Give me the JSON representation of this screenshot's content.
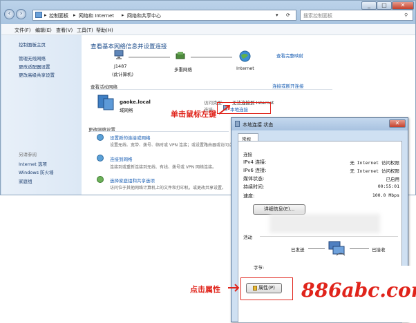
{
  "window": {
    "breadcrumb": [
      "控制面板",
      "网络和 Internet",
      "网络和共享中心"
    ],
    "search_placeholder": "搜索控制面板",
    "controls": {
      "min": "_",
      "max": "□",
      "close": "✕"
    }
  },
  "menu": [
    "文件(F)",
    "编辑(E)",
    "查看(V)",
    "工具(T)",
    "帮助(H)"
  ],
  "sidebar": {
    "items": [
      "控制面板主页",
      "管理无线网络",
      "更改适配器设置",
      "更改高级共享设置"
    ],
    "see_also_title": "另请参阅",
    "see_also": [
      "Internet 选项",
      "Windows 防火墙",
      "家庭组"
    ]
  },
  "main": {
    "heading": "查看基本网络信息并设置连接",
    "full_map": "查看完整映射",
    "map_nodes": [
      {
        "label": "J1487",
        "sub": "(此计算机)"
      },
      {
        "label": "多重网络",
        "sub": ""
      },
      {
        "label": "Internet",
        "sub": ""
      }
    ],
    "active_title": "查看活动网络",
    "connect_link": "连接或断开连接",
    "network": {
      "name": "gaoke.local",
      "type": "域网络"
    },
    "access_type_label": "访问类型:",
    "access_type_value": "无法连接到 Internet",
    "connection_label": "连接:",
    "connection_value": "本地连接",
    "change_title": "更改网络设置",
    "tasks": [
      {
        "title": "设置新的连接或网络",
        "desc": "设置无线、宽带、拨号、临时或 VPN 连接；或设置路由器或访问点。"
      },
      {
        "title": "连接到网络",
        "desc": "连接到或重新连接到无线、有线、拨号或 VPN 网络连接。"
      },
      {
        "title": "选择家庭组和共享选项",
        "desc": "访问位于其他网络计算机上的文件和打印机，或更改共享设置。"
      }
    ]
  },
  "dialog": {
    "title": "本地连接 状态",
    "tab": "常规",
    "connection_section": "连接",
    "rows": [
      {
        "k": "IPv4 连接:",
        "v": "无 Internet 访问权限"
      },
      {
        "k": "IPv6 连接:",
        "v": "无 Internet 访问权限"
      },
      {
        "k": "媒体状态:",
        "v": "已启用"
      },
      {
        "k": "持续时间:",
        "v": "00:55:01"
      },
      {
        "k": "速度:",
        "v": "100.0 Mbps"
      }
    ],
    "details_button": "详细信息(E)...",
    "activity_section": "活动",
    "sent_label": "已发送",
    "received_label": "已接收",
    "bytes_label": "字节:",
    "properties_button": "属性(P)",
    "disable_button": "禁"
  },
  "annotations": {
    "left_click": "单击鼠标左键",
    "click_properties": "点击属性",
    "watermark": "886abc.com"
  }
}
